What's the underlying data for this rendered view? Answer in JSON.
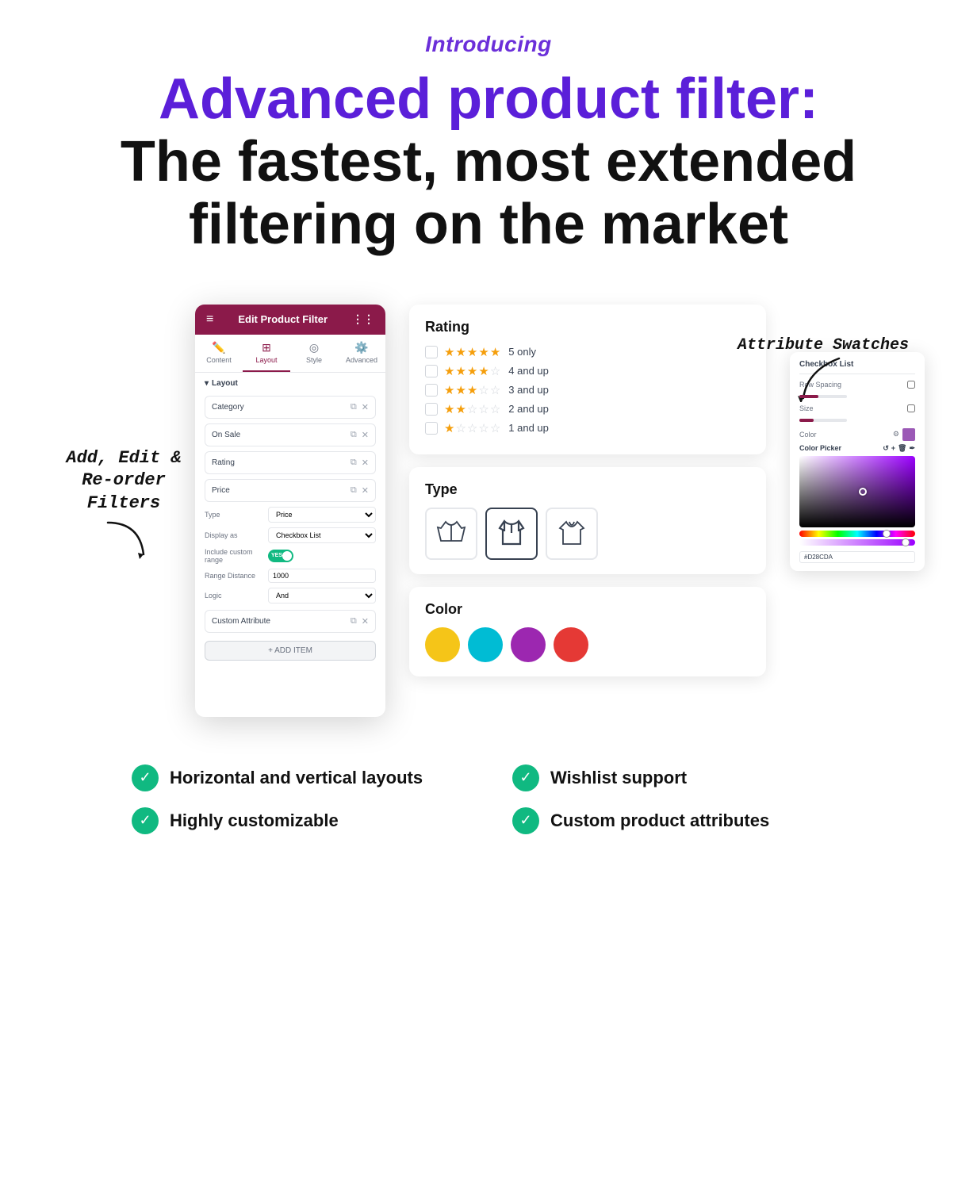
{
  "header": {
    "introducing": "Introducing",
    "headline_blue": "Advanced product filter:",
    "headline_black": "The fastest, most extended filtering on the market"
  },
  "filter_panel": {
    "title": "Edit Product Filter",
    "tabs": [
      {
        "label": "Content",
        "icon": "✏️"
      },
      {
        "label": "Layout",
        "icon": "⊞"
      },
      {
        "label": "Style",
        "icon": "◎"
      },
      {
        "label": "Advanced",
        "icon": "⚙️"
      }
    ],
    "section_label": "Layout",
    "filters": [
      {
        "name": "Category"
      },
      {
        "name": "On Sale"
      },
      {
        "name": "Rating"
      },
      {
        "name": "Price"
      }
    ],
    "form_rows": [
      {
        "label": "Type",
        "value": "Price"
      },
      {
        "label": "Display as",
        "value": "Checkbox List"
      },
      {
        "label": "Include custom range",
        "value": "Yes"
      },
      {
        "label": "Range Distance",
        "value": "1000"
      },
      {
        "label": "Logic",
        "value": "And"
      }
    ],
    "custom_attribute": "Custom Attribute",
    "add_item": "+ ADD ITEM"
  },
  "rating_section": {
    "title": "Rating",
    "rows": [
      {
        "stars": 5,
        "label": "5 only"
      },
      {
        "stars": 4,
        "label": "4 and up"
      },
      {
        "stars": 3,
        "label": "3 and up"
      },
      {
        "stars": 2,
        "label": "2 and up"
      },
      {
        "stars": 1,
        "label": "1 and up"
      }
    ]
  },
  "type_section": {
    "title": "Type",
    "icons": [
      "🧥",
      "🧥",
      "🧥"
    ]
  },
  "color_section": {
    "title": "Color",
    "swatches": [
      "#F5C518",
      "#00BCD4",
      "#9C27B0",
      "#E53935"
    ]
  },
  "swatch_panel": {
    "title": "Checkbox List",
    "row_spacing_label": "Row Spacing",
    "size_label": "Size",
    "color_label": "Color",
    "color_picker_label": "Color Picker",
    "hex_value": "#D28CDA"
  },
  "annotations": {
    "left": "Add, Edit &\nRe-order\nFilters",
    "right": "Attribute Swatches"
  },
  "features": [
    {
      "label": "Horizontal and vertical layouts"
    },
    {
      "label": "Wishlist support"
    },
    {
      "label": "Highly customizable"
    },
    {
      "label": "Custom product attributes"
    }
  ]
}
